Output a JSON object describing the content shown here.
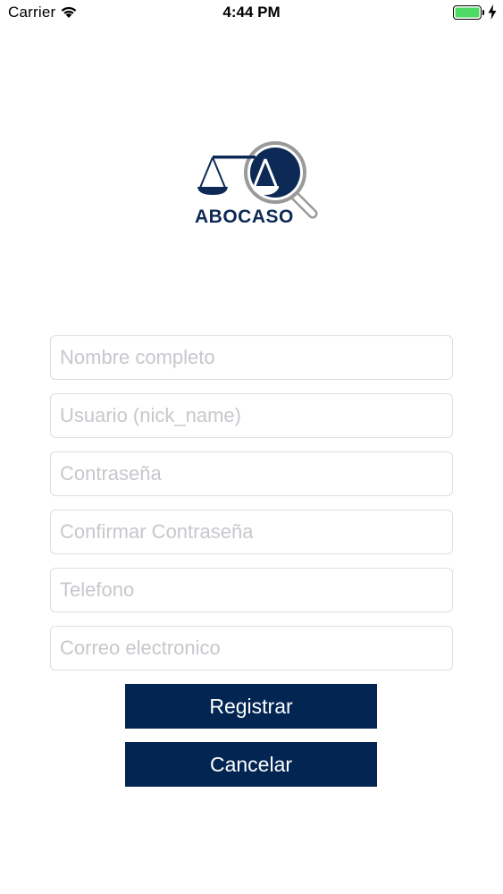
{
  "status_bar": {
    "carrier": "Carrier",
    "time": "4:44 PM",
    "icons": [
      "wifi-icon",
      "battery-icon",
      "charging-bolt-icon"
    ],
    "battery_color": "#4cd964"
  },
  "logo": {
    "text": "ABOCASO",
    "icon": "scales-magnifier-icon",
    "color": "#0d2a57"
  },
  "form": {
    "fields": [
      {
        "placeholder": "Nombre completo",
        "value": ""
      },
      {
        "placeholder": "Usuario (nick_name)",
        "value": ""
      },
      {
        "placeholder": "Contraseña",
        "value": ""
      },
      {
        "placeholder": "Confirmar Contraseña",
        "value": ""
      },
      {
        "placeholder": "Telefono",
        "value": ""
      },
      {
        "placeholder": "Correo electronico",
        "value": ""
      }
    ],
    "register_label": "Registrar",
    "cancel_label": "Cancelar",
    "button_color": "#032552"
  }
}
